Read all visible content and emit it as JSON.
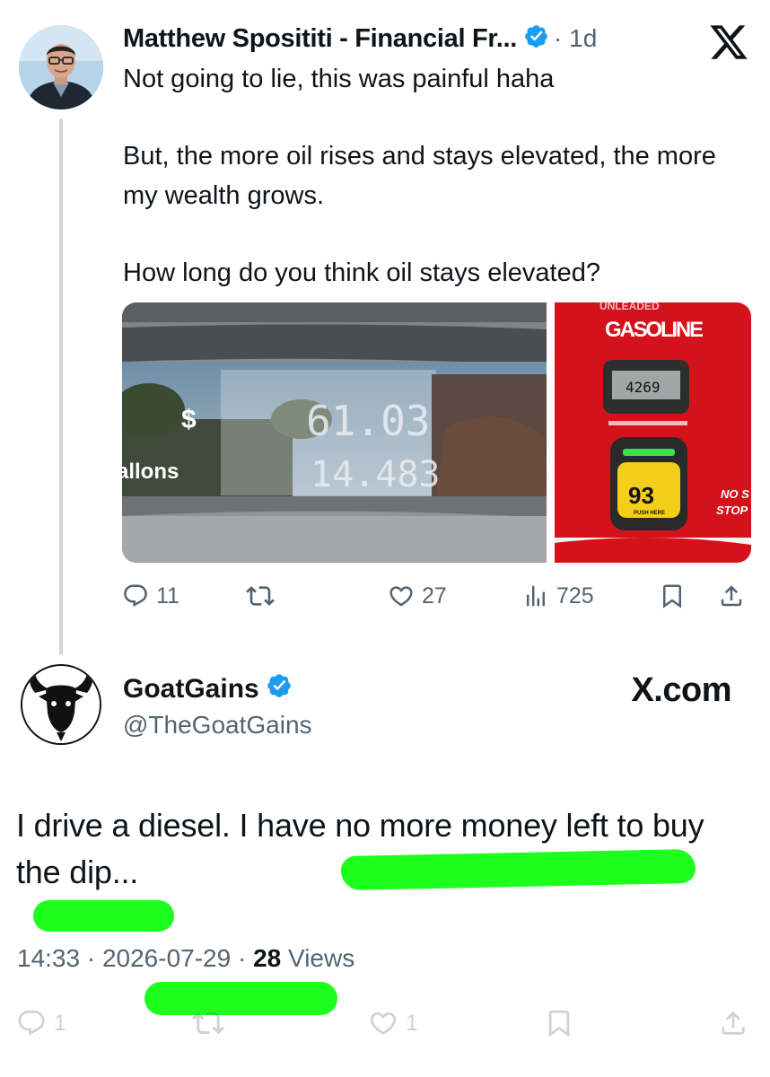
{
  "original_tweet": {
    "author_name": "Matthew Sposititi - Financial Fr...",
    "time": "1d",
    "paragraphs": [
      "Not going to lie, this was painful haha",
      "But, the more oil rises and stays elevated, the more my wealth grows.",
      "How long do you think oil stays elevated?"
    ],
    "image1": {
      "pump_dollar": "$",
      "pump_gallons": "allons",
      "display_dollars": "61.03",
      "display_gallons": "14.483"
    },
    "image2": {
      "header_partial": "UNLEADED",
      "title": "GASOLINE",
      "price": "4269",
      "octane": "93",
      "push_here": "PUSH HERE",
      "side_label_1": "NO S",
      "side_label_2": "STOP"
    },
    "stats": {
      "replies": "11",
      "likes": "27",
      "views": "725"
    }
  },
  "reply_tweet": {
    "author_name": "GoatGains",
    "handle": "@TheGoatGains",
    "brand": "X.com",
    "text": "I drive a diesel. I have no more money left to buy the dip...",
    "time": "14:33",
    "date": "2026-07-29",
    "views_count": "28",
    "views_label": "Views",
    "stats": {
      "replies": "1",
      "likes": "1"
    }
  },
  "colors": {
    "verified_blue": "#1d9bf0",
    "highlight_green": "#1dff1d",
    "muted_text": "#536471"
  }
}
